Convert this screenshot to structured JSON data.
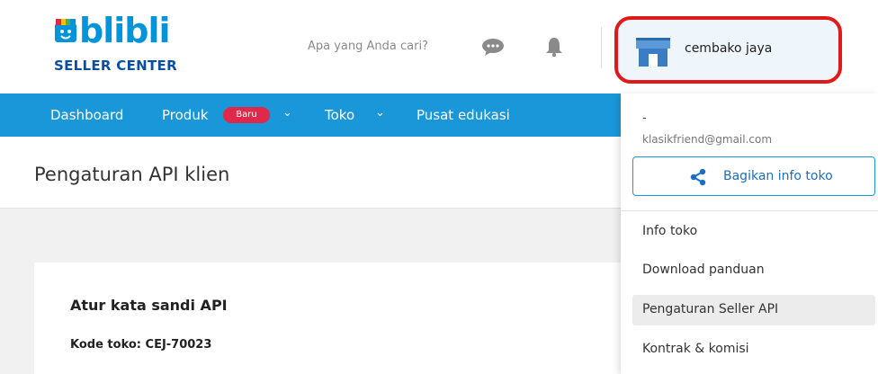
{
  "header": {
    "logo_text": "blibli",
    "logo_sub": "SELLER CENTER",
    "search_placeholder": "Apa yang Anda cari?",
    "store_name": "cembako jaya"
  },
  "nav": {
    "items": [
      {
        "label": "Dashboard"
      },
      {
        "label": "Produk"
      },
      {
        "label": "Toko"
      },
      {
        "label": "Pusat edukasi"
      }
    ],
    "badge": "Baru"
  },
  "page": {
    "title": "Pengaturan API klien"
  },
  "card": {
    "title": "Atur kata sandi API",
    "code_label": "Kode toko: CEJ-70023"
  },
  "dropdown": {
    "name": "-",
    "email": "klasikfriend@gmail.com",
    "share_label": "Bagikan info toko",
    "items": [
      {
        "label": "Info toko"
      },
      {
        "label": "Download panduan"
      },
      {
        "label": "Pengaturan Seller API"
      },
      {
        "label": "Kontrak & komisi"
      }
    ]
  },
  "colors": {
    "brand_blue": "#0095da",
    "nav_blue": "#1a97d8",
    "highlight_red": "#e01a1a",
    "badge_red": "#e0284a"
  }
}
